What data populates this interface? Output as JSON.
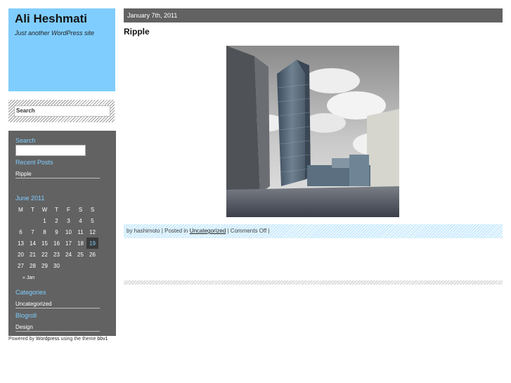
{
  "site": {
    "title": "Ali Heshmati",
    "description": "Just another WordPress site"
  },
  "search_top": {
    "placeholder": "Search"
  },
  "sidebar": {
    "search_title": "Search",
    "recent_posts_title": "Recent Posts",
    "recent_posts": [
      {
        "label": "Ripple"
      }
    ],
    "calendar": {
      "caption": "June 2011",
      "weekdays": [
        "M",
        "T",
        "W",
        "T",
        "F",
        "S",
        "S"
      ],
      "weeks": [
        [
          "",
          "",
          "1",
          "2",
          "3",
          "4",
          "5"
        ],
        [
          "6",
          "7",
          "8",
          "9",
          "10",
          "11",
          "12"
        ],
        [
          "13",
          "14",
          "15",
          "16",
          "17",
          "18",
          "19"
        ],
        [
          "20",
          "21",
          "22",
          "23",
          "24",
          "25",
          "26"
        ],
        [
          "27",
          "28",
          "29",
          "30",
          "",
          "",
          ""
        ]
      ],
      "today": "19",
      "prev_link": "« Jan"
    },
    "categories_title": "Categories",
    "categories": [
      {
        "label": "Uncategorized"
      }
    ],
    "blogroll_title": "Blogroll",
    "blogroll": [
      {
        "label": "Design"
      }
    ]
  },
  "footer": {
    "prefix": "Powered by ",
    "wordpress": "Wordpress",
    "middle": " using the theme ",
    "theme": "bbv1"
  },
  "post": {
    "date": "January 7th, 2011",
    "title": "Ripple",
    "image_alt": "Rendering of a glass high-rise tower among buildings",
    "meta": {
      "by": "by hashimoto | Posted in ",
      "category": "Uncategorized",
      "after": " | Comments Off |"
    }
  },
  "colors": {
    "header_bg": "#7fcdff",
    "sidebar_bg": "#626262",
    "accent": "#7fcdff",
    "datebar_bg": "#626262"
  }
}
